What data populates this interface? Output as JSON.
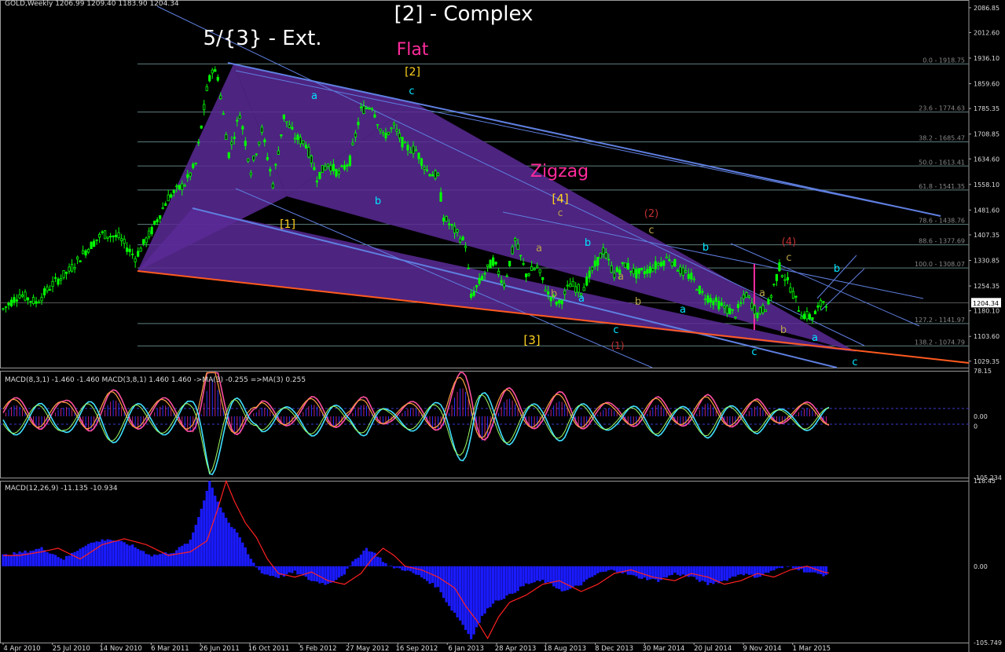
{
  "header": "GOLD,Weekly  1206.99 1209.40 1183.90 1204.34",
  "colors": {
    "background": "#000000",
    "bull": "#00ff00",
    "bear": "#00ff00",
    "grid": "#444444",
    "fib": "#5f7f7f",
    "channel": "#5f7fe0",
    "triangle": "#5a2a96",
    "baseline": "#ff5a1f",
    "cyan": "#00e5ff",
    "yellow": "#ffd21f",
    "magenta": "#ff2b9c",
    "red": "#c03030",
    "olive": "#b9a44a",
    "histogram": "#1a1aff",
    "signal": "#ff2020"
  },
  "chart_data": [
    {
      "type": "candlestick",
      "title": "",
      "symbol": "GOLD",
      "timeframe": "Weekly",
      "ylim": [
        1010,
        2110
      ],
      "x_start": "4 Apr 2010",
      "x_end": "1 Mar 2015",
      "last_price": "1204.34",
      "price_ticks": [
        "2086.85",
        "2012.60",
        "1936.10",
        "1859.60",
        "1785.35",
        "1708.85",
        "1634.60",
        "1558.10",
        "1481.60",
        "1407.35",
        "1330.85",
        "1254.35",
        "1180.10",
        "1103.60",
        "1029.35"
      ],
      "x_ticks": [
        "4 Apr 2010",
        "25 Jul 2010",
        "14 Nov 2010",
        "6 Mar 2011",
        "26 Jun 2011",
        "16 Oct 2011",
        "5 Feb 2012",
        "27 May 2012",
        "16 Sep 2012",
        "6 Jan 2013",
        "28 Apr 2013",
        "18 Aug 2013",
        "8 Dec 2013",
        "30 Mar 2014",
        "20 Jul 2014",
        "9 Nov 2014",
        "1 Mar 2015"
      ],
      "price_path": [
        [
          0,
          1185
        ],
        [
          6,
          1230
        ],
        [
          12,
          1205
        ],
        [
          18,
          1260
        ],
        [
          24,
          1300
        ],
        [
          30,
          1360
        ],
        [
          36,
          1410
        ],
        [
          42,
          1400
        ],
        [
          48,
          1340
        ],
        [
          54,
          1420
        ],
        [
          60,
          1520
        ],
        [
          66,
          1560
        ],
        [
          70,
          1620
        ],
        [
          74,
          1840
        ],
        [
          76,
          1905
        ],
        [
          78,
          1880
        ],
        [
          82,
          1650
        ],
        [
          86,
          1770
        ],
        [
          90,
          1600
        ],
        [
          94,
          1720
        ],
        [
          98,
          1560
        ],
        [
          102,
          1760
        ],
        [
          106,
          1700
        ],
        [
          110,
          1680
        ],
        [
          114,
          1580
        ],
        [
          118,
          1620
        ],
        [
          122,
          1590
        ],
        [
          126,
          1630
        ],
        [
          130,
          1780
        ],
        [
          134,
          1795
        ],
        [
          138,
          1700
        ],
        [
          142,
          1730
        ],
        [
          146,
          1670
        ],
        [
          150,
          1660
        ],
        [
          154,
          1600
        ],
        [
          158,
          1580
        ],
        [
          160,
          1460
        ],
        [
          164,
          1420
        ],
        [
          168,
          1380
        ],
        [
          170,
          1220
        ],
        [
          174,
          1280
        ],
        [
          178,
          1330
        ],
        [
          182,
          1260
        ],
        [
          186,
          1390
        ],
        [
          190,
          1290
        ],
        [
          194,
          1310
        ],
        [
          198,
          1230
        ],
        [
          202,
          1200
        ],
        [
          206,
          1260
        ],
        [
          210,
          1240
        ],
        [
          214,
          1300
        ],
        [
          218,
          1360
        ],
        [
          222,
          1290
        ],
        [
          226,
          1320
        ],
        [
          230,
          1290
        ],
        [
          234,
          1300
        ],
        [
          238,
          1320
        ],
        [
          242,
          1340
        ],
        [
          246,
          1300
        ],
        [
          250,
          1280
        ],
        [
          254,
          1230
        ],
        [
          258,
          1210
        ],
        [
          262,
          1190
        ],
        [
          266,
          1170
        ],
        [
          270,
          1230
        ],
        [
          274,
          1170
        ],
        [
          278,
          1200
        ],
        [
          282,
          1310
        ],
        [
          286,
          1250
        ],
        [
          290,
          1170
        ],
        [
          294,
          1160
        ],
        [
          298,
          1210
        ],
        [
          300,
          1204
        ]
      ],
      "fib_levels": [
        {
          "label": "0.0 - 1918.75",
          "price": 1918.75
        },
        {
          "label": "23.6 - 1774.63",
          "price": 1774.63
        },
        {
          "label": "38.2 - 1685.47",
          "price": 1685.47
        },
        {
          "label": "50.0 - 1613.41",
          "price": 1613.41
        },
        {
          "label": "61.8 - 1541.35",
          "price": 1541.35
        },
        {
          "label": "78.6 - 1438.76",
          "price": 1438.76
        },
        {
          "label": "88.6 - 1377.69",
          "price": 1377.69
        },
        {
          "label": "100.0 - 1308.07",
          "price": 1308.07
        },
        {
          "label": "127.2 - 1141.97",
          "price": 1141.97
        },
        {
          "label": "138.2 - 1074.79",
          "price": 1074.79
        }
      ],
      "annotations": [
        {
          "text": "[2] - Complex",
          "color": "white",
          "size": "xl"
        },
        {
          "text": "5/{3} - Ext.",
          "color": "white",
          "size": "xl"
        },
        {
          "text": "Flat",
          "color": "magenta",
          "size": "l"
        },
        {
          "text": "Zigzag",
          "color": "magenta",
          "size": "l"
        },
        {
          "text": "[2]",
          "color": "yellow"
        },
        {
          "text": "[1]",
          "color": "yellow"
        },
        {
          "text": "[3]",
          "color": "yellow"
        },
        {
          "text": "[4]",
          "color": "yellow"
        },
        {
          "text": "a",
          "color": "cyan"
        },
        {
          "text": "b",
          "color": "cyan"
        },
        {
          "text": "c",
          "color": "cyan"
        },
        {
          "text": "c",
          "color": "olive"
        },
        {
          "text": "(2)",
          "color": "red"
        },
        {
          "text": "(4)",
          "color": "red"
        },
        {
          "text": "(1)",
          "color": "red"
        }
      ]
    },
    {
      "type": "line",
      "title": "MACD(8,3,1) -1.460 -1.460  MACD(3,8,1) 1.460 1.460  ->MA(3) -0.255  =>MA(3) 0.255",
      "ylim": [
        -105.234,
        78.15
      ],
      "ticks": [
        "78.15",
        "0.00",
        "0",
        "-105.234"
      ]
    },
    {
      "type": "bar",
      "title": "MACD(12,26,9) -11.135 -10.934",
      "ylim": [
        -105.749,
        118.45
      ],
      "ticks": [
        "118.45",
        "0.00",
        "-105.749"
      ],
      "histogram_path": [
        [
          0,
          15
        ],
        [
          8,
          20
        ],
        [
          14,
          25
        ],
        [
          22,
          10
        ],
        [
          30,
          30
        ],
        [
          38,
          38
        ],
        [
          46,
          30
        ],
        [
          54,
          15
        ],
        [
          62,
          20
        ],
        [
          68,
          35
        ],
        [
          72,
          80
        ],
        [
          75,
          118
        ],
        [
          78,
          90
        ],
        [
          82,
          60
        ],
        [
          86,
          40
        ],
        [
          90,
          10
        ],
        [
          94,
          -10
        ],
        [
          100,
          -15
        ],
        [
          106,
          -8
        ],
        [
          112,
          -20
        ],
        [
          118,
          -25
        ],
        [
          124,
          -10
        ],
        [
          128,
          10
        ],
        [
          132,
          25
        ],
        [
          136,
          15
        ],
        [
          140,
          0
        ],
        [
          146,
          -5
        ],
        [
          152,
          -15
        ],
        [
          158,
          -30
        ],
        [
          162,
          -55
        ],
        [
          166,
          -75
        ],
        [
          170,
          -100
        ],
        [
          174,
          -70
        ],
        [
          178,
          -50
        ],
        [
          184,
          -40
        ],
        [
          190,
          -25
        ],
        [
          196,
          -20
        ],
        [
          204,
          -35
        ],
        [
          210,
          -25
        ],
        [
          216,
          -10
        ],
        [
          222,
          -5
        ],
        [
          230,
          -15
        ],
        [
          238,
          -20
        ],
        [
          244,
          -10
        ],
        [
          250,
          -15
        ],
        [
          256,
          -25
        ],
        [
          262,
          -20
        ],
        [
          268,
          -10
        ],
        [
          274,
          -15
        ],
        [
          280,
          -5
        ],
        [
          286,
          0
        ],
        [
          292,
          -8
        ],
        [
          298,
          -12
        ],
        [
          300,
          -11
        ]
      ]
    }
  ]
}
